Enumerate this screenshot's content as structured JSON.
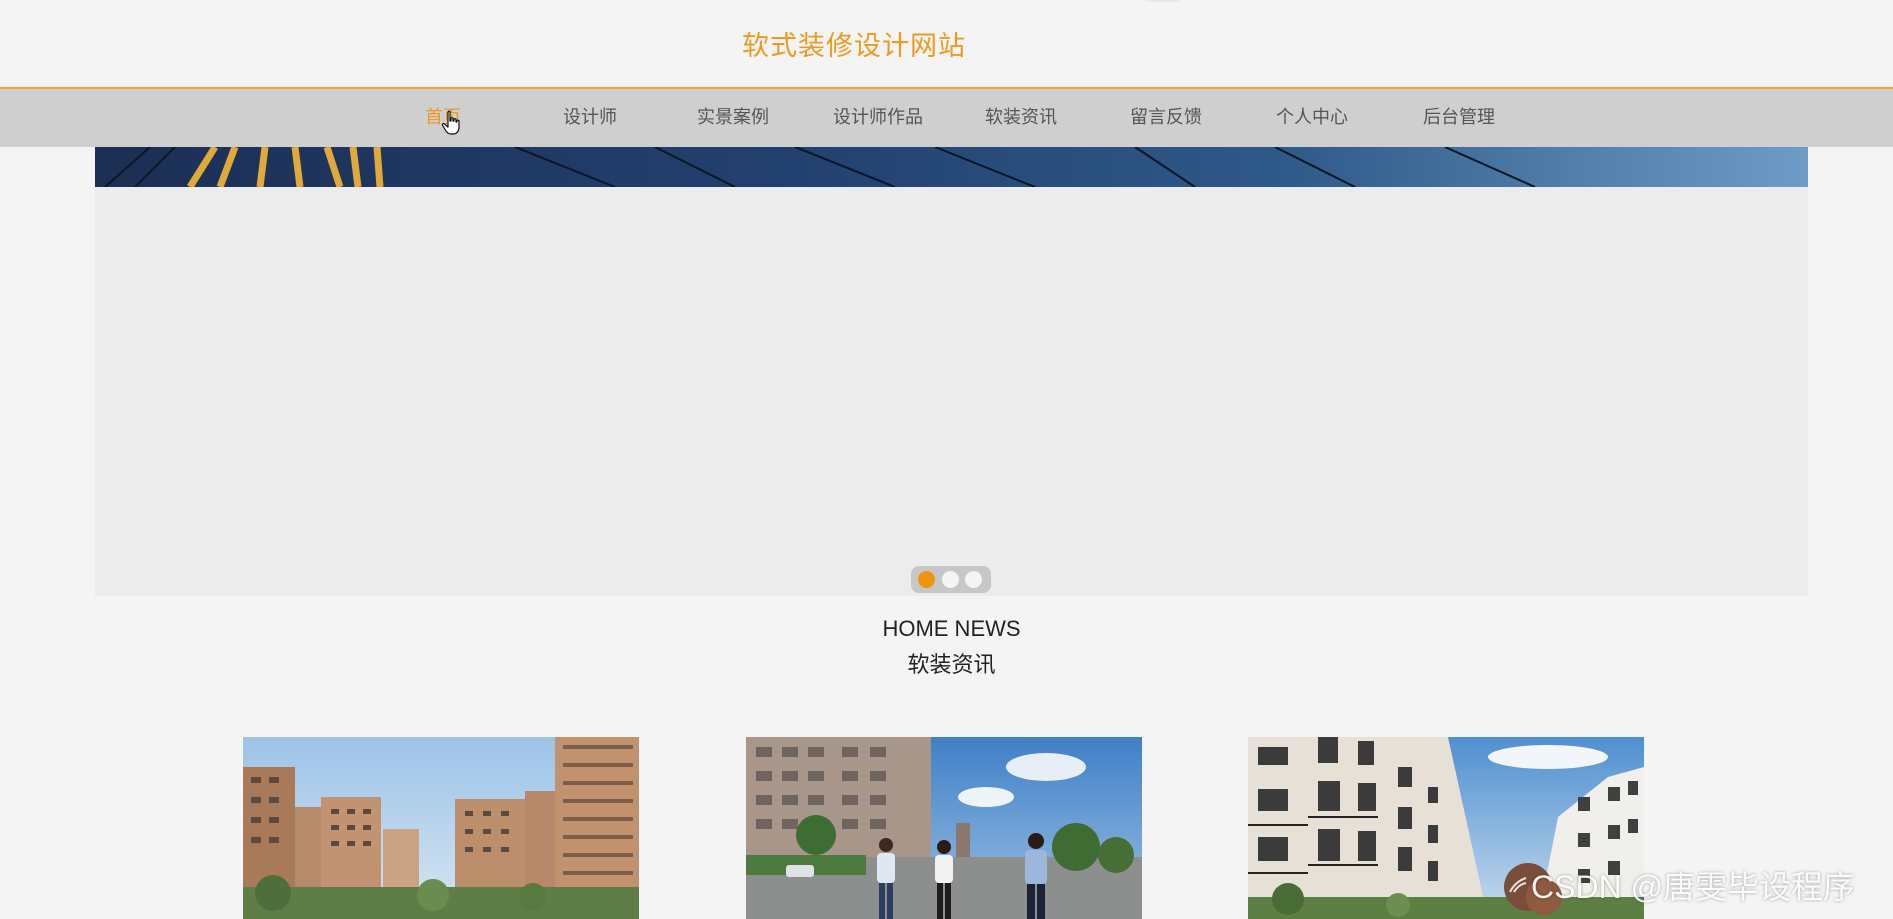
{
  "site": {
    "title": "软式装修设计网站",
    "accent_color": "#ef9a1e"
  },
  "nav": {
    "items": [
      {
        "label": "首页",
        "active": true
      },
      {
        "label": "设计师",
        "active": false
      },
      {
        "label": "实景案例",
        "active": false
      },
      {
        "label": "设计师作品",
        "active": false
      },
      {
        "label": "软装资讯",
        "active": false
      },
      {
        "label": "留言反馈",
        "active": false
      },
      {
        "label": "个人中心",
        "active": false
      },
      {
        "label": "后台管理",
        "active": false
      }
    ]
  },
  "banner": {
    "slide_count": 3,
    "active_slide": 1
  },
  "news_section": {
    "heading_en": "HOME NEWS",
    "heading_cn": "软装资讯",
    "cards": [
      {
        "image": "residential-towers-photo"
      },
      {
        "image": "people-walking-street-photo"
      },
      {
        "image": "apartment-building-photo"
      }
    ]
  },
  "watermark": {
    "text": "CSDN @唐雯毕设程序"
  }
}
